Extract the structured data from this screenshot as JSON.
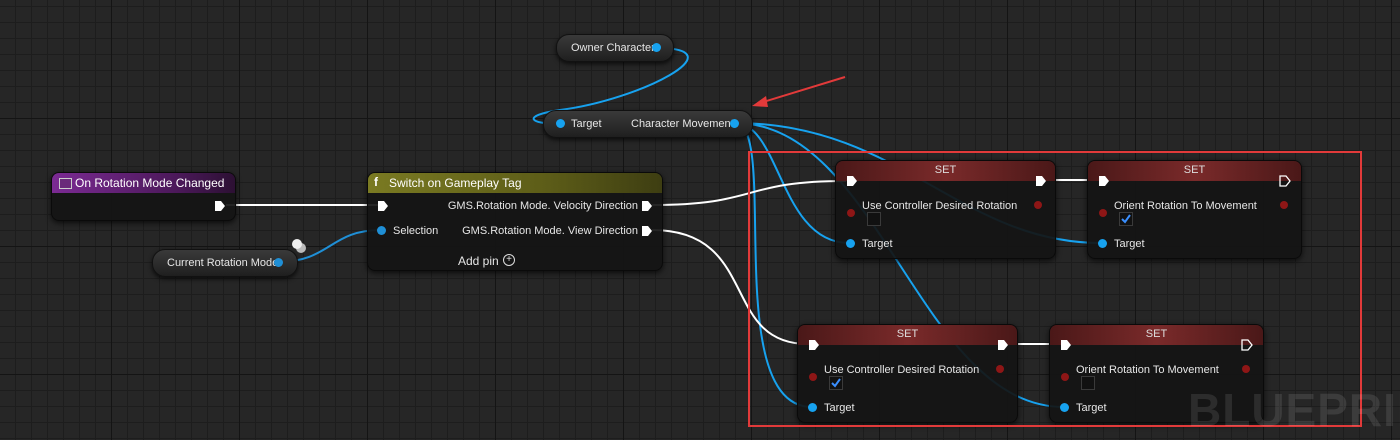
{
  "graph": {
    "watermark": "BLUEPRIN"
  },
  "colors": {
    "object_pin": "#17a2ef",
    "exec_wire": "#ffffff",
    "bool_pin": "#8e1616",
    "set_header": "#7a2a2a",
    "highlight": "#e23a3a",
    "event_header": "#6a1b80",
    "switch_header": "#6e6e1a"
  },
  "nodes": {
    "event": {
      "title": "On Rotation Mode Changed",
      "icon": "event-icon"
    },
    "current_rotation_mode": {
      "label": "Current Rotation Mode"
    },
    "switch": {
      "title": "Switch on Gameplay Tag",
      "icon": "function-icon",
      "selection": "Selection",
      "out1": "GMS.Rotation Mode. Velocity Direction",
      "out2": "GMS.Rotation Mode. View Direction",
      "add_pin": "Add pin"
    },
    "owner_character": {
      "label": "Owner Character"
    },
    "character_movement": {
      "target": "Target",
      "output": "Character Movement"
    },
    "set1": {
      "title": "SET",
      "var": "Use Controller Desired Rotation",
      "checked": false,
      "target": "Target"
    },
    "set2": {
      "title": "SET",
      "var": "Orient Rotation To Movement",
      "checked": true,
      "target": "Target"
    },
    "set3": {
      "title": "SET",
      "var": "Use Controller Desired Rotation",
      "checked": true,
      "target": "Target"
    },
    "set4": {
      "title": "SET",
      "var": "Orient Rotation To Movement",
      "checked": false,
      "target": "Target"
    }
  }
}
